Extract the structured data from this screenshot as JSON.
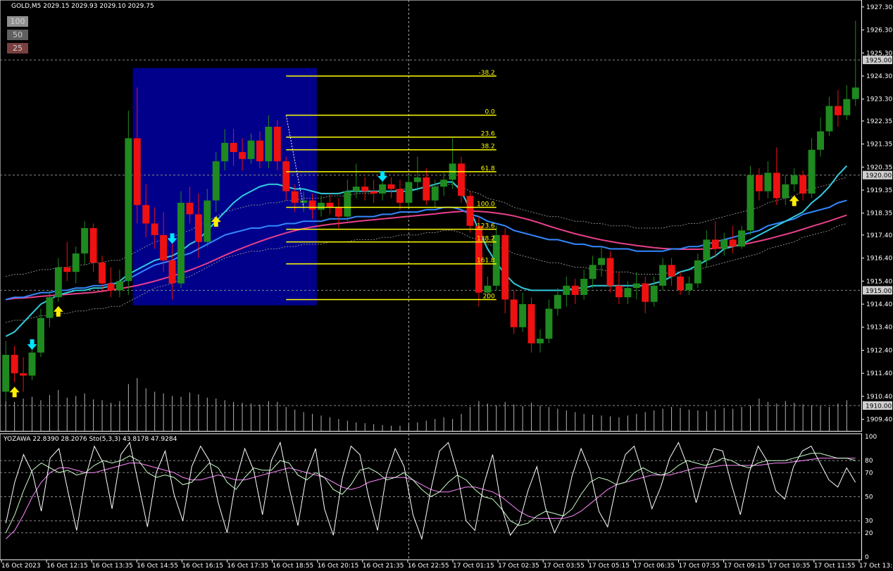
{
  "header": {
    "symbol_line": "GOLD,M5  2029.15 2029.93 2029.10 2029.75"
  },
  "lookback_buttons": [
    {
      "label": "100",
      "bg": "#909090"
    },
    {
      "label": "50",
      "bg": "#606060"
    },
    {
      "label": "25",
      "bg": "#7a4040"
    }
  ],
  "indicator_header": "YOZAWA 22.8390 28.2076  Sto(5,3,3) 43.8178 47.9284",
  "colors": {
    "background": "#000000",
    "bull_bar": "#1f8a1f",
    "bear_bar": "#ee1111",
    "fib": "#ffff00",
    "fib_box": "#00008b",
    "ma_fast": "#33ccdd",
    "ma_slow": "#3388ff",
    "ma_long": "#e8408a",
    "volume": "#b4b4b4",
    "stoch_main": "#ffffff",
    "stoch_k": "#c8ffc8",
    "stoch_d": "#ff88ff",
    "arrow_up": "#ffee00",
    "arrow_down": "#00e5ff"
  },
  "chart_data": {
    "type": "candlestick",
    "symbol": "GOLD",
    "timeframe": "M5",
    "price_axis": {
      "ylim": [
        1908.9,
        1927.6
      ],
      "ticks": [
        "1927.30",
        "1926.30",
        "1925.30",
        "1924.30",
        "1923.30",
        "1922.35",
        "1921.35",
        "1920.35",
        "1919.35",
        "1918.35",
        "1917.40",
        "1916.40",
        "1915.40",
        "1914.40",
        "1913.40",
        "1912.40",
        "1911.40",
        "1910.40",
        "1909.40"
      ],
      "tick_values": [
        1927.3,
        1926.3,
        1925.3,
        1924.3,
        1923.3,
        1922.35,
        1921.35,
        1920.35,
        1919.35,
        1918.35,
        1917.4,
        1916.4,
        1915.4,
        1914.4,
        1913.4,
        1912.4,
        1911.4,
        1910.4,
        1909.4
      ],
      "marked_levels": [
        {
          "label": "1925.00",
          "value": 1925.0
        },
        {
          "label": "1920.00",
          "value": 1920.0
        },
        {
          "label": "1915.00",
          "value": 1915.0
        },
        {
          "label": "1910.00",
          "value": 1910.0
        }
      ]
    },
    "time_axis": {
      "labels": [
        "16 Oct 2023",
        "16 Oct 12:15",
        "16 Oct 13:35",
        "16 Oct 14:55",
        "16 Oct 16:15",
        "16 Oct 17:35",
        "16 Oct 18:55",
        "16 Oct 20:15",
        "16 Oct 21:35",
        "16 Oct 22:55",
        "17 Oct 01:15",
        "17 Oct 02:35",
        "17 Oct 03:55",
        "17 Oct 05:15",
        "17 Oct 06:35",
        "17 Oct 07:55",
        "17 Oct 09:15",
        "17 Oct 10:35",
        "17 Oct 11:55",
        "17 Oct 13:15"
      ]
    },
    "fibonacci": {
      "levels": [
        {
          "label": "-38.2",
          "price": 1924.3
        },
        {
          "label": "0.0",
          "price": 1922.6
        },
        {
          "label": "23.6",
          "price": 1921.65
        },
        {
          "label": "38.2",
          "price": 1921.1
        },
        {
          "label": "61.8",
          "price": 1920.15
        },
        {
          "label": "100.0",
          "price": 1918.6
        },
        {
          "label": "123.6",
          "price": 1917.65
        },
        {
          "label": "138.2",
          "price": 1917.1
        },
        {
          "label": "161.8",
          "price": 1916.15
        },
        {
          "label": "200",
          "price": 1914.6
        }
      ]
    },
    "bars": [
      {
        "o": 1910.6,
        "h": 1912.8,
        "l": 1910.2,
        "c": 1912.2
      },
      {
        "o": 1912.2,
        "h": 1912.6,
        "l": 1911.0,
        "c": 1911.4
      },
      {
        "o": 1911.4,
        "h": 1912.1,
        "l": 1910.6,
        "c": 1911.3
      },
      {
        "o": 1911.3,
        "h": 1912.6,
        "l": 1911.1,
        "c": 1912.3
      },
      {
        "o": 1912.3,
        "h": 1914.2,
        "l": 1912.1,
        "c": 1913.8
      },
      {
        "o": 1913.8,
        "h": 1915.0,
        "l": 1913.4,
        "c": 1914.7
      },
      {
        "o": 1914.7,
        "h": 1916.4,
        "l": 1914.5,
        "c": 1916.0
      },
      {
        "o": 1916.0,
        "h": 1917.1,
        "l": 1915.4,
        "c": 1915.8
      },
      {
        "o": 1915.8,
        "h": 1916.9,
        "l": 1915.3,
        "c": 1916.6
      },
      {
        "o": 1916.6,
        "h": 1918.0,
        "l": 1916.1,
        "c": 1917.7
      },
      {
        "o": 1917.7,
        "h": 1917.9,
        "l": 1915.8,
        "c": 1916.2
      },
      {
        "o": 1916.2,
        "h": 1916.5,
        "l": 1914.9,
        "c": 1915.3
      },
      {
        "o": 1915.3,
        "h": 1916.0,
        "l": 1914.7,
        "c": 1915.0
      },
      {
        "o": 1915.0,
        "h": 1915.9,
        "l": 1914.7,
        "c": 1915.4
      },
      {
        "o": 1915.4,
        "h": 1922.8,
        "l": 1914.8,
        "c": 1921.6
      },
      {
        "o": 1921.6,
        "h": 1923.8,
        "l": 1917.9,
        "c": 1918.7
      },
      {
        "o": 1918.7,
        "h": 1919.6,
        "l": 1917.3,
        "c": 1917.9
      },
      {
        "o": 1917.9,
        "h": 1918.6,
        "l": 1916.8,
        "c": 1917.4
      },
      {
        "o": 1917.4,
        "h": 1918.4,
        "l": 1915.8,
        "c": 1916.3
      },
      {
        "o": 1916.3,
        "h": 1917.2,
        "l": 1914.6,
        "c": 1915.3
      },
      {
        "o": 1915.3,
        "h": 1919.3,
        "l": 1915.1,
        "c": 1918.8
      },
      {
        "o": 1918.8,
        "h": 1919.5,
        "l": 1917.9,
        "c": 1918.3
      },
      {
        "o": 1918.3,
        "h": 1919.2,
        "l": 1916.4,
        "c": 1917.1
      },
      {
        "o": 1917.1,
        "h": 1919.4,
        "l": 1916.9,
        "c": 1918.9
      },
      {
        "o": 1918.9,
        "h": 1921.0,
        "l": 1918.4,
        "c": 1920.6
      },
      {
        "o": 1920.6,
        "h": 1922.0,
        "l": 1920.2,
        "c": 1921.4
      },
      {
        "o": 1921.4,
        "h": 1922.0,
        "l": 1920.4,
        "c": 1921.0
      },
      {
        "o": 1921.0,
        "h": 1921.6,
        "l": 1920.2,
        "c": 1920.7
      },
      {
        "o": 1920.7,
        "h": 1921.8,
        "l": 1920.5,
        "c": 1921.5
      },
      {
        "o": 1921.5,
        "h": 1921.9,
        "l": 1920.3,
        "c": 1920.6
      },
      {
        "o": 1920.6,
        "h": 1922.6,
        "l": 1920.3,
        "c": 1922.1
      },
      {
        "o": 1922.1,
        "h": 1922.4,
        "l": 1920.2,
        "c": 1920.6
      },
      {
        "o": 1920.6,
        "h": 1920.8,
        "l": 1918.9,
        "c": 1919.3
      },
      {
        "o": 1919.3,
        "h": 1919.6,
        "l": 1918.4,
        "c": 1918.8
      },
      {
        "o": 1918.8,
        "h": 1919.3,
        "l": 1918.4,
        "c": 1918.9
      },
      {
        "o": 1918.9,
        "h": 1919.2,
        "l": 1918.1,
        "c": 1918.5
      },
      {
        "o": 1918.5,
        "h": 1919.1,
        "l": 1918.2,
        "c": 1918.8
      },
      {
        "o": 1918.8,
        "h": 1919.2,
        "l": 1918.3,
        "c": 1918.6
      },
      {
        "o": 1918.6,
        "h": 1919.0,
        "l": 1917.7,
        "c": 1918.2
      },
      {
        "o": 1918.2,
        "h": 1919.8,
        "l": 1918.0,
        "c": 1919.3
      },
      {
        "o": 1919.3,
        "h": 1920.5,
        "l": 1919.0,
        "c": 1919.5
      },
      {
        "o": 1919.5,
        "h": 1919.9,
        "l": 1918.9,
        "c": 1919.3
      },
      {
        "o": 1919.3,
        "h": 1919.8,
        "l": 1918.8,
        "c": 1919.2
      },
      {
        "o": 1919.2,
        "h": 1919.9,
        "l": 1918.9,
        "c": 1919.6
      },
      {
        "o": 1919.6,
        "h": 1919.9,
        "l": 1919.0,
        "c": 1919.4
      },
      {
        "o": 1919.4,
        "h": 1919.8,
        "l": 1918.5,
        "c": 1918.8
      },
      {
        "o": 1918.8,
        "h": 1920.0,
        "l": 1918.6,
        "c": 1919.7
      },
      {
        "o": 1919.7,
        "h": 1920.8,
        "l": 1919.3,
        "c": 1919.9
      },
      {
        "o": 1919.9,
        "h": 1920.3,
        "l": 1918.7,
        "c": 1918.9
      },
      {
        "o": 1918.9,
        "h": 1919.8,
        "l": 1918.6,
        "c": 1919.5
      },
      {
        "o": 1919.5,
        "h": 1920.1,
        "l": 1919.1,
        "c": 1919.8
      },
      {
        "o": 1919.8,
        "h": 1921.6,
        "l": 1919.4,
        "c": 1920.5
      },
      {
        "o": 1920.5,
        "h": 1920.8,
        "l": 1918.8,
        "c": 1919.1
      },
      {
        "o": 1919.1,
        "h": 1919.3,
        "l": 1917.5,
        "c": 1917.8
      },
      {
        "o": 1917.8,
        "h": 1918.2,
        "l": 1914.3,
        "c": 1914.9
      },
      {
        "o": 1914.9,
        "h": 1915.6,
        "l": 1914.6,
        "c": 1915.2
      },
      {
        "o": 1915.2,
        "h": 1917.8,
        "l": 1915.0,
        "c": 1917.4
      },
      {
        "o": 1917.4,
        "h": 1917.7,
        "l": 1914.0,
        "c": 1914.6
      },
      {
        "o": 1914.6,
        "h": 1915.0,
        "l": 1913.1,
        "c": 1913.4
      },
      {
        "o": 1913.4,
        "h": 1914.9,
        "l": 1913.2,
        "c": 1914.4
      },
      {
        "o": 1914.4,
        "h": 1914.7,
        "l": 1912.3,
        "c": 1912.7
      },
      {
        "o": 1912.7,
        "h": 1913.3,
        "l": 1912.3,
        "c": 1912.9
      },
      {
        "o": 1912.9,
        "h": 1914.6,
        "l": 1912.7,
        "c": 1914.2
      },
      {
        "o": 1914.2,
        "h": 1915.1,
        "l": 1913.9,
        "c": 1914.8
      },
      {
        "o": 1914.8,
        "h": 1915.6,
        "l": 1914.3,
        "c": 1915.2
      },
      {
        "o": 1915.2,
        "h": 1915.5,
        "l": 1914.4,
        "c": 1914.8
      },
      {
        "o": 1914.8,
        "h": 1915.9,
        "l": 1914.6,
        "c": 1915.5
      },
      {
        "o": 1915.5,
        "h": 1916.5,
        "l": 1915.1,
        "c": 1916.1
      },
      {
        "o": 1916.1,
        "h": 1916.9,
        "l": 1915.6,
        "c": 1916.4
      },
      {
        "o": 1916.4,
        "h": 1916.7,
        "l": 1914.9,
        "c": 1915.2
      },
      {
        "o": 1915.2,
        "h": 1915.8,
        "l": 1914.4,
        "c": 1914.7
      },
      {
        "o": 1914.7,
        "h": 1915.4,
        "l": 1914.4,
        "c": 1915.1
      },
      {
        "o": 1915.1,
        "h": 1915.8,
        "l": 1914.6,
        "c": 1915.3
      },
      {
        "o": 1915.3,
        "h": 1915.6,
        "l": 1914.0,
        "c": 1914.5
      },
      {
        "o": 1914.5,
        "h": 1915.6,
        "l": 1914.3,
        "c": 1915.2
      },
      {
        "o": 1915.2,
        "h": 1916.4,
        "l": 1915.0,
        "c": 1916.1
      },
      {
        "o": 1916.1,
        "h": 1916.4,
        "l": 1915.2,
        "c": 1915.6
      },
      {
        "o": 1915.6,
        "h": 1915.8,
        "l": 1914.8,
        "c": 1915.0
      },
      {
        "o": 1915.0,
        "h": 1915.6,
        "l": 1914.8,
        "c": 1915.3
      },
      {
        "o": 1915.3,
        "h": 1916.6,
        "l": 1915.1,
        "c": 1916.3
      },
      {
        "o": 1916.3,
        "h": 1917.6,
        "l": 1916.0,
        "c": 1917.2
      },
      {
        "o": 1917.2,
        "h": 1918.0,
        "l": 1916.4,
        "c": 1916.8
      },
      {
        "o": 1916.8,
        "h": 1917.5,
        "l": 1916.5,
        "c": 1917.2
      },
      {
        "o": 1917.2,
        "h": 1917.8,
        "l": 1916.6,
        "c": 1916.9
      },
      {
        "o": 1916.9,
        "h": 1917.8,
        "l": 1916.8,
        "c": 1917.6
      },
      {
        "o": 1917.6,
        "h": 1920.4,
        "l": 1917.4,
        "c": 1920.0
      },
      {
        "o": 1920.0,
        "h": 1920.3,
        "l": 1918.9,
        "c": 1919.3
      },
      {
        "o": 1919.3,
        "h": 1920.6,
        "l": 1919.0,
        "c": 1920.1
      },
      {
        "o": 1920.1,
        "h": 1921.2,
        "l": 1918.7,
        "c": 1919.0
      },
      {
        "o": 1919.0,
        "h": 1920.0,
        "l": 1918.7,
        "c": 1919.6
      },
      {
        "o": 1919.6,
        "h": 1920.3,
        "l": 1919.3,
        "c": 1920.0
      },
      {
        "o": 1920.0,
        "h": 1920.2,
        "l": 1918.9,
        "c": 1919.2
      },
      {
        "o": 1919.2,
        "h": 1921.6,
        "l": 1919.0,
        "c": 1921.1
      },
      {
        "o": 1921.1,
        "h": 1922.5,
        "l": 1920.8,
        "c": 1921.9
      },
      {
        "o": 1921.9,
        "h": 1923.4,
        "l": 1921.7,
        "c": 1923.0
      },
      {
        "o": 1923.0,
        "h": 1923.7,
        "l": 1922.1,
        "c": 1922.6
      },
      {
        "o": 1922.6,
        "h": 1923.9,
        "l": 1922.4,
        "c": 1923.3
      },
      {
        "o": 1923.3,
        "h": 1926.7,
        "l": 1923.0,
        "c": 1923.8
      }
    ],
    "ma_fast": [
      1913.0,
      1913.2,
      1913.6,
      1914.0,
      1914.4,
      1914.6,
      1914.8,
      1914.9,
      1915.0,
      1915.0,
      1915.1,
      1915.1,
      1915.2,
      1915.4,
      1915.7,
      1915.9,
      1916.1,
      1916.3,
      1916.4,
      1916.5,
      1916.7,
      1917.0,
      1917.2,
      1917.6,
      1918.0,
      1918.4,
      1918.8,
      1919.1,
      1919.3,
      1919.5,
      1919.6,
      1919.6,
      1919.5,
      1919.4,
      1919.4,
      1919.3,
      1919.2,
      1919.2,
      1919.2,
      1919.3,
      1919.3,
      1919.3,
      1919.3,
      1919.3,
      1919.3,
      1919.3,
      1919.3,
      1919.4,
      1919.5,
      1919.6,
      1919.7,
      1919.7,
      1919.3,
      1918.5,
      1917.6,
      1916.8,
      1916.2,
      1915.7,
      1915.3,
      1915.1,
      1915.0,
      1915.0,
      1915.0,
      1915.0,
      1915.0,
      1915.1,
      1915.1,
      1915.2,
      1915.2,
      1915.2,
      1915.2,
      1915.2,
      1915.2,
      1915.2,
      1915.3,
      1915.4,
      1915.6,
      1915.8,
      1915.9,
      1916.1,
      1916.3,
      1916.5,
      1916.8,
      1916.9,
      1917.0,
      1917.2,
      1917.4,
      1917.6,
      1917.8,
      1918.0,
      1918.2,
      1918.4,
      1918.8,
      1919.1,
      1919.5,
      1920.0,
      1920.4
    ],
    "ma_slow": [
      1914.6,
      1914.7,
      1914.7,
      1914.8,
      1914.9,
      1914.9,
      1915.0,
      1915.0,
      1915.1,
      1915.1,
      1915.2,
      1915.2,
      1915.3,
      1915.3,
      1915.5,
      1915.7,
      1915.9,
      1916.1,
      1916.2,
      1916.3,
      1916.5,
      1916.6,
      1916.8,
      1917.0,
      1917.2,
      1917.4,
      1917.5,
      1917.6,
      1917.7,
      1917.7,
      1917.8,
      1917.8,
      1917.9,
      1917.9,
      1918.0,
      1918.0,
      1918.0,
      1918.1,
      1918.1,
      1918.1,
      1918.2,
      1918.2,
      1918.2,
      1918.3,
      1918.3,
      1918.4,
      1918.4,
      1918.4,
      1918.5,
      1918.5,
      1918.6,
      1918.6,
      1918.5,
      1918.3,
      1918.2,
      1918.0,
      1917.9,
      1917.8,
      1917.6,
      1917.5,
      1917.4,
      1917.3,
      1917.2,
      1917.2,
      1917.1,
      1917.0,
      1917.0,
      1916.9,
      1916.9,
      1916.8,
      1916.8,
      1916.8,
      1916.7,
      1916.7,
      1916.7,
      1916.7,
      1916.8,
      1916.8,
      1916.9,
      1916.9,
      1917.0,
      1917.1,
      1917.2,
      1917.3,
      1917.4,
      1917.5,
      1917.6,
      1917.8,
      1917.9,
      1918.0,
      1918.1,
      1918.3,
      1918.4,
      1918.5,
      1918.6,
      1918.8,
      1918.9
    ]
  },
  "volume_data": [
    35,
    34,
    38,
    40,
    36,
    42,
    48,
    39,
    41,
    44,
    37,
    36,
    33,
    35,
    55,
    62,
    50,
    46,
    44,
    41,
    40,
    45,
    43,
    39,
    38,
    36,
    34,
    33,
    32,
    31,
    35,
    34,
    28,
    25,
    22,
    20,
    18,
    16,
    14,
    12,
    10,
    9,
    8,
    7,
    6,
    6,
    8,
    10,
    12,
    14,
    16,
    14,
    20,
    28,
    35,
    32,
    30,
    34,
    31,
    29,
    33,
    30,
    28,
    26,
    24,
    22,
    20,
    19,
    18,
    17,
    16,
    18,
    20,
    22,
    24,
    26,
    28,
    27,
    25,
    24,
    23,
    25,
    27,
    26,
    28,
    30,
    38,
    34,
    32,
    35,
    33,
    31,
    30,
    29,
    28,
    32,
    36
  ],
  "stochastic_data": {
    "levels": [
      "100",
      "80",
      "70",
      "50",
      "30",
      "20",
      "0"
    ],
    "main": [
      28,
      62,
      85,
      70,
      38,
      82,
      90,
      55,
      22,
      66,
      92,
      78,
      40,
      85,
      95,
      60,
      25,
      70,
      88,
      52,
      30,
      75,
      92,
      80,
      45,
      20,
      64,
      90,
      72,
      35,
      80,
      95,
      58,
      26,
      70,
      90,
      40,
      18,
      65,
      92,
      85,
      50,
      22,
      68,
      90,
      75,
      35,
      15,
      55,
      88,
      95,
      70,
      30,
      22,
      60,
      85,
      42,
      18,
      28,
      55,
      75,
      40,
      20,
      35,
      68,
      90,
      72,
      38,
      25,
      60,
      85,
      92,
      68,
      40,
      58,
      82,
      95,
      76,
      45,
      72,
      90,
      88,
      60,
      35,
      70,
      92,
      80,
      55,
      48,
      75,
      88,
      92,
      78,
      64,
      58,
      74,
      62
    ],
    "k": [
      20,
      35,
      55,
      72,
      78,
      74,
      70,
      72,
      68,
      70,
      76,
      80,
      78,
      80,
      84,
      80,
      70,
      66,
      68,
      66,
      60,
      62,
      70,
      78,
      74,
      62,
      56,
      66,
      74,
      72,
      72,
      80,
      78,
      68,
      64,
      70,
      66,
      56,
      52,
      60,
      72,
      74,
      70,
      64,
      66,
      70,
      64,
      56,
      50,
      54,
      62,
      68,
      64,
      56,
      50,
      48,
      40,
      30,
      26,
      28,
      34,
      38,
      36,
      34,
      40,
      52,
      62,
      66,
      64,
      60,
      62,
      70,
      74,
      70,
      68,
      70,
      76,
      80,
      78,
      76,
      78,
      82,
      80,
      76,
      74,
      78,
      80,
      80,
      80,
      82,
      84,
      86,
      86,
      84,
      82,
      82,
      80
    ],
    "d": [
      15,
      22,
      35,
      50,
      62,
      70,
      74,
      74,
      72,
      70,
      70,
      72,
      74,
      76,
      78,
      78,
      76,
      74,
      72,
      70,
      66,
      64,
      64,
      66,
      68,
      66,
      64,
      64,
      66,
      68,
      70,
      72,
      74,
      72,
      70,
      68,
      66,
      62,
      58,
      56,
      58,
      62,
      64,
      66,
      66,
      66,
      64,
      60,
      56,
      54,
      54,
      56,
      58,
      58,
      56,
      54,
      50,
      44,
      38,
      34,
      32,
      32,
      32,
      32,
      34,
      38,
      44,
      50,
      56,
      60,
      62,
      64,
      66,
      68,
      68,
      68,
      70,
      72,
      74,
      74,
      75,
      76,
      76,
      76,
      76,
      76,
      77,
      78,
      78,
      79,
      80,
      81,
      82,
      82,
      82,
      82,
      82
    ]
  },
  "signal_arrows": {
    "up_bar_index": [
      1,
      6,
      24,
      90
    ],
    "down_bar_index": [
      3,
      19,
      43
    ]
  }
}
